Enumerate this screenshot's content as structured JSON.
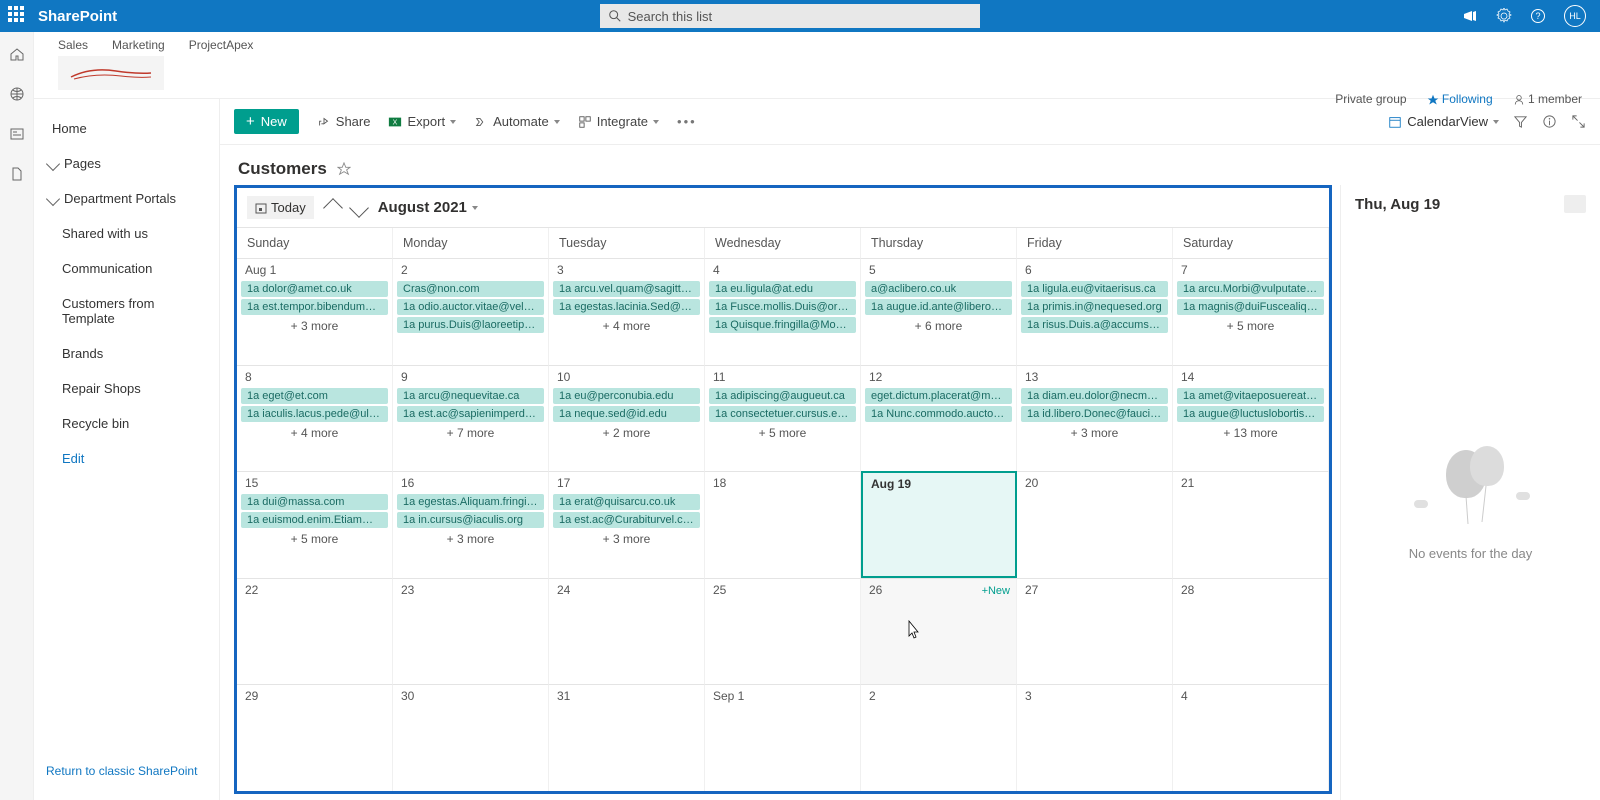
{
  "header": {
    "brand": "SharePoint",
    "search_placeholder": "Search this list",
    "avatar_initials": "HL"
  },
  "site": {
    "tabs": [
      "Sales",
      "Marketing",
      "ProjectApex"
    ],
    "group_type": "Private group",
    "following": "Following",
    "members": "1 member"
  },
  "leftnav": {
    "home": "Home",
    "pages": "Pages",
    "dept": "Department Portals",
    "items": [
      "Shared with us",
      "Communication",
      "Customers from Template",
      "Brands",
      "Repair Shops",
      "Recycle bin"
    ],
    "edit": "Edit",
    "classic": "Return to classic SharePoint"
  },
  "cmdbar": {
    "new": "New",
    "share": "Share",
    "export": "Export",
    "automate": "Automate",
    "integrate": "Integrate",
    "view": "CalendarView"
  },
  "title": "Customers",
  "cal": {
    "today": "Today",
    "month": "August 2021",
    "days": [
      "Sunday",
      "Monday",
      "Tuesday",
      "Wednesday",
      "Thursday",
      "Friday",
      "Saturday"
    ],
    "cells": [
      {
        "date": "Aug 1",
        "events": [
          "1a dolor@amet.co.uk",
          "1a est.tempor.bibendum…"
        ],
        "more": "+ 3 more"
      },
      {
        "date": "2",
        "events": [
          "Cras@non.com",
          "1a odio.auctor.vitae@vel…",
          "1a purus.Duis@laoreetips…"
        ],
        "more": ""
      },
      {
        "date": "3",
        "events": [
          "1a arcu.vel.quam@sagitti…",
          "1a egestas.lacinia.Sed@ve…"
        ],
        "more": "+ 4 more"
      },
      {
        "date": "4",
        "events": [
          "1a eu.ligula@at.edu",
          "1a Fusce.mollis.Duis@orci…",
          "1a Quisque.fringilla@Mor…"
        ],
        "more": ""
      },
      {
        "date": "5",
        "events": [
          "a@aclibero.co.uk",
          "1a augue.id.ante@libero…"
        ],
        "more": "+ 6 more"
      },
      {
        "date": "6",
        "events": [
          "1a ligula.eu@vitaerisus.ca",
          "1a primis.in@nequesed.org",
          "1a risus.Duis.a@accumsa…"
        ],
        "more": ""
      },
      {
        "date": "7",
        "events": [
          "1a arcu.Morbi@vulputate…",
          "1a magnis@duiFuscealiqu…"
        ],
        "more": "+ 5 more"
      },
      {
        "date": "8",
        "events": [
          "1a eget@et.com",
          "1a iaculis.lacus.pede@ultr…"
        ],
        "more": "+ 4 more"
      },
      {
        "date": "9",
        "events": [
          "1a arcu@nequevitae.ca",
          "1a est.ac@sapienimperdi…"
        ],
        "more": "+ 7 more"
      },
      {
        "date": "10",
        "events": [
          "1a eu@perconubia.edu",
          "1a neque.sed@id.edu"
        ],
        "more": "+ 2 more"
      },
      {
        "date": "11",
        "events": [
          "1a adipiscing@augueut.ca",
          "1a consectetuer.cursus.et…"
        ],
        "more": "+ 5 more"
      },
      {
        "date": "12",
        "events": [
          "eget.dictum.placerat@ma…",
          "1a Nunc.commodo.auctor…"
        ],
        "more": ""
      },
      {
        "date": "13",
        "events": [
          "1a diam.eu.dolor@necme…",
          "1a id.libero.Donec@fauci…"
        ],
        "more": "+ 3 more"
      },
      {
        "date": "14",
        "events": [
          "1a amet@vitaeposuereat…",
          "1a augue@luctuslobortis…"
        ],
        "more": "+ 13 more"
      },
      {
        "date": "15",
        "events": [
          "1a dui@massa.com",
          "1a euismod.enim.Etiam@…"
        ],
        "more": "+ 5 more"
      },
      {
        "date": "16",
        "events": [
          "1a egestas.Aliquam.fringil…",
          "1a in.cursus@iaculis.org"
        ],
        "more": "+ 3 more"
      },
      {
        "date": "17",
        "events": [
          "1a erat@quisarcu.co.uk",
          "1a est.ac@Curabiturvel.co…"
        ],
        "more": "+ 3 more"
      },
      {
        "date": "18",
        "events": [],
        "more": ""
      },
      {
        "date": "Aug 19",
        "events": [],
        "more": "",
        "selected": true
      },
      {
        "date": "20",
        "events": [],
        "more": ""
      },
      {
        "date": "21",
        "events": [],
        "more": ""
      },
      {
        "date": "22",
        "events": [],
        "more": ""
      },
      {
        "date": "23",
        "events": [],
        "more": ""
      },
      {
        "date": "24",
        "events": [],
        "more": ""
      },
      {
        "date": "25",
        "events": [],
        "more": ""
      },
      {
        "date": "26",
        "events": [],
        "more": "",
        "hover": true,
        "quicknew": "+New"
      },
      {
        "date": "27",
        "events": [],
        "more": ""
      },
      {
        "date": "28",
        "events": [],
        "more": ""
      },
      {
        "date": "29",
        "events": [],
        "more": ""
      },
      {
        "date": "30",
        "events": [],
        "more": ""
      },
      {
        "date": "31",
        "events": [],
        "more": ""
      },
      {
        "date": "Sep 1",
        "events": [],
        "more": ""
      },
      {
        "date": "2",
        "events": [],
        "more": ""
      },
      {
        "date": "3",
        "events": [],
        "more": ""
      },
      {
        "date": "4",
        "events": [],
        "more": ""
      }
    ]
  },
  "side": {
    "date": "Thu, Aug 19",
    "empty": "No events for the day"
  }
}
